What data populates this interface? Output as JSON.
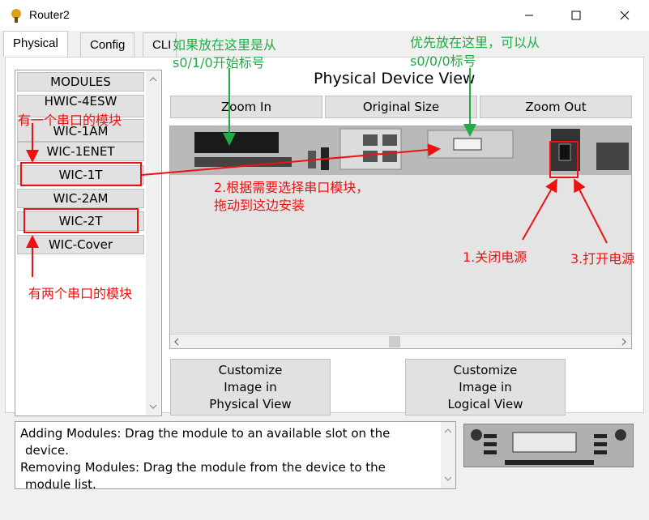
{
  "window": {
    "title": "Router2"
  },
  "tabs": [
    "Physical",
    "Config",
    "CLI"
  ],
  "modules": {
    "items": [
      "MODULES",
      "HWIC-4ESW",
      "WIC-1AM",
      "WIC-1ENET",
      "WIC-1T",
      "WIC-2AM",
      "WIC-2T",
      "WIC-Cover"
    ]
  },
  "view": {
    "title": "Physical Device View",
    "zoom_in": "Zoom In",
    "original_size": "Original Size",
    "zoom_out": "Zoom Out"
  },
  "customize": {
    "physical": [
      "Customize",
      "Image in",
      "Physical View"
    ],
    "logical": [
      "Customize",
      "Image in",
      "Logical View"
    ]
  },
  "info": {
    "line1": "Adding Modules: Drag the module to an available slot on the",
    "line2": "device.",
    "line3": "Removing Modules: Drag the module from the device to the",
    "line4": "module list."
  },
  "annotations": {
    "one_serial": "有一个串口的模块",
    "two_serial": "有两个串口的模块",
    "place_here_1": "如果放在这里是从",
    "place_here_1b": "s0/1/0开始标号",
    "place_here_2": "优先放在这里，可以从",
    "place_here_2b": "s0/0/0标号",
    "drag_1": "2.根据需要选择串口模块，",
    "drag_2": "拖动到这边安装",
    "power_off": "1.关闭电源",
    "power_on": "3.打开电源"
  },
  "colors": {
    "annotation_red": "#ee1111",
    "annotation_green": "#22aa44"
  }
}
